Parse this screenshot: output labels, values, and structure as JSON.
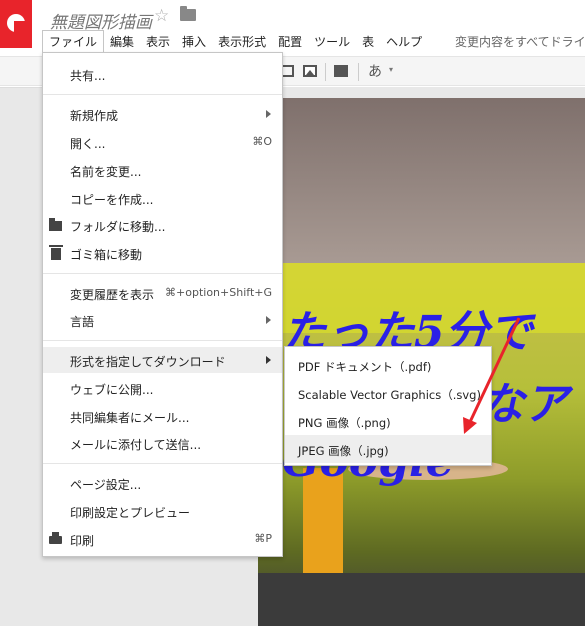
{
  "app": {
    "title": "無題図形描画",
    "star_glyph": "☆",
    "save_status": "変更内容をすべてドライ",
    "brand_color": "#e8242b"
  },
  "menubar": {
    "items": [
      "ファイル",
      "編集",
      "表示",
      "挿入",
      "表示形式",
      "配置",
      "ツール",
      "表",
      "ヘルプ"
    ],
    "active_item": "ファイル"
  },
  "toolbar": {
    "font_button": "あ",
    "icons": [
      "textbox-icon",
      "image-icon",
      "comment-icon"
    ]
  },
  "file_menu": {
    "items": [
      {
        "label": "共有..."
      },
      {
        "label": "新規作成",
        "submenu": true
      },
      {
        "label": "開く...",
        "shortcut": "⌘O"
      },
      {
        "label": "名前を変更..."
      },
      {
        "label": "コピーを作成..."
      },
      {
        "label": "フォルダに移動...",
        "icon": "folder-icon"
      },
      {
        "label": "ゴミ箱に移動",
        "icon": "trash-icon"
      },
      {
        "label": "変更履歴を表示",
        "shortcut": "⌘+option+Shift+G"
      },
      {
        "label": "言語",
        "submenu": true
      },
      {
        "label": "形式を指定してダウンロード",
        "submenu": true,
        "highlighted": true
      },
      {
        "label": "ウェブに公開..."
      },
      {
        "label": "共同編集者にメール..."
      },
      {
        "label": "メールに添付して送信..."
      },
      {
        "label": "ページ設定..."
      },
      {
        "label": "印刷設定とプレビュー"
      },
      {
        "label": "印刷",
        "shortcut": "⌘P",
        "icon": "print-icon"
      }
    ]
  },
  "download_submenu": {
    "items": [
      {
        "label": "PDF ドキュメント（.pdf)"
      },
      {
        "label": "Scalable Vector Graphics（.svg)"
      },
      {
        "label": "PNG 画像（.png)"
      },
      {
        "label": "JPEG 画像（.jpg)",
        "highlighted": true
      }
    ]
  },
  "slide": {
    "line1": "たった5分で",
    "line2": "なア",
    "line3": "Google",
    "text_color": "#2a20e6"
  },
  "annotation": {
    "arrow_color": "#e8242b"
  }
}
